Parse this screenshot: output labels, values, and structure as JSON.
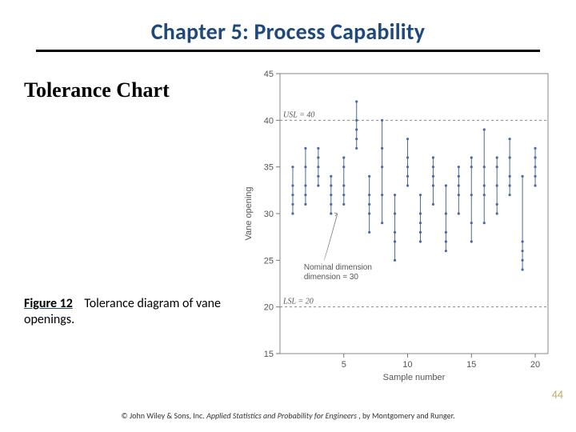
{
  "chapter_title": "Chapter 5: Process Capability",
  "section_title": "Tolerance Chart",
  "caption": {
    "fig_num": "Figure 12",
    "text": "Tolerance diagram of vane openings."
  },
  "page_num": "44",
  "copyright_prefix": "© John Wiley & Sons, Inc.  ",
  "copyright_src": "Applied Statistics and Probability for Engineers",
  "copyright_suffix": ", by Montgomery and Runger.",
  "chart_data": {
    "type": "scatter",
    "xlabel": "Sample number",
    "ylabel": "Vane opening",
    "x_ticks": [
      5,
      10,
      15,
      20
    ],
    "y_ticks": [
      15,
      20,
      25,
      30,
      35,
      40,
      45
    ],
    "ylim": [
      15,
      45
    ],
    "xlim": [
      0,
      21
    ],
    "usl": 40,
    "usl_label": "USL = 40",
    "lsl": 20,
    "lsl_label": "LSL = 20",
    "nominal": 30,
    "nominal_label": "Nominal dimension = 30",
    "series": [
      {
        "x": 1,
        "values": [
          33,
          30,
          35,
          32,
          31
        ]
      },
      {
        "x": 2,
        "values": [
          33,
          31,
          35,
          37,
          32
        ]
      },
      {
        "x": 3,
        "values": [
          35,
          37,
          33,
          34,
          36
        ]
      },
      {
        "x": 4,
        "values": [
          30,
          31,
          33,
          34,
          32
        ]
      },
      {
        "x": 5,
        "values": [
          33,
          35,
          36,
          32,
          31
        ]
      },
      {
        "x": 6,
        "values": [
          38,
          39,
          40,
          37,
          42
        ]
      },
      {
        "x": 7,
        "values": [
          30,
          31,
          32,
          34,
          28
        ]
      },
      {
        "x": 8,
        "values": [
          29,
          40,
          35,
          32,
          37
        ]
      },
      {
        "x": 9,
        "values": [
          28,
          30,
          32,
          25,
          27
        ]
      },
      {
        "x": 10,
        "values": [
          38,
          33,
          35,
          36,
          34
        ]
      },
      {
        "x": 11,
        "values": [
          28,
          30,
          29,
          27,
          32
        ]
      },
      {
        "x": 12,
        "values": [
          31,
          35,
          34,
          36,
          33
        ]
      },
      {
        "x": 13,
        "values": [
          27,
          33,
          26,
          30,
          28
        ]
      },
      {
        "x": 14,
        "values": [
          33,
          30,
          34,
          32,
          35
        ]
      },
      {
        "x": 15,
        "values": [
          35,
          36,
          29,
          27,
          32
        ]
      },
      {
        "x": 16,
        "values": [
          33,
          35,
          29,
          39,
          32
        ]
      },
      {
        "x": 17,
        "values": [
          35,
          36,
          30,
          31,
          33
        ]
      },
      {
        "x": 18,
        "values": [
          32,
          34,
          36,
          38,
          33
        ]
      },
      {
        "x": 19,
        "values": [
          25,
          27,
          34,
          26,
          24
        ]
      },
      {
        "x": 20,
        "values": [
          35,
          36,
          37,
          34,
          33
        ]
      }
    ]
  }
}
